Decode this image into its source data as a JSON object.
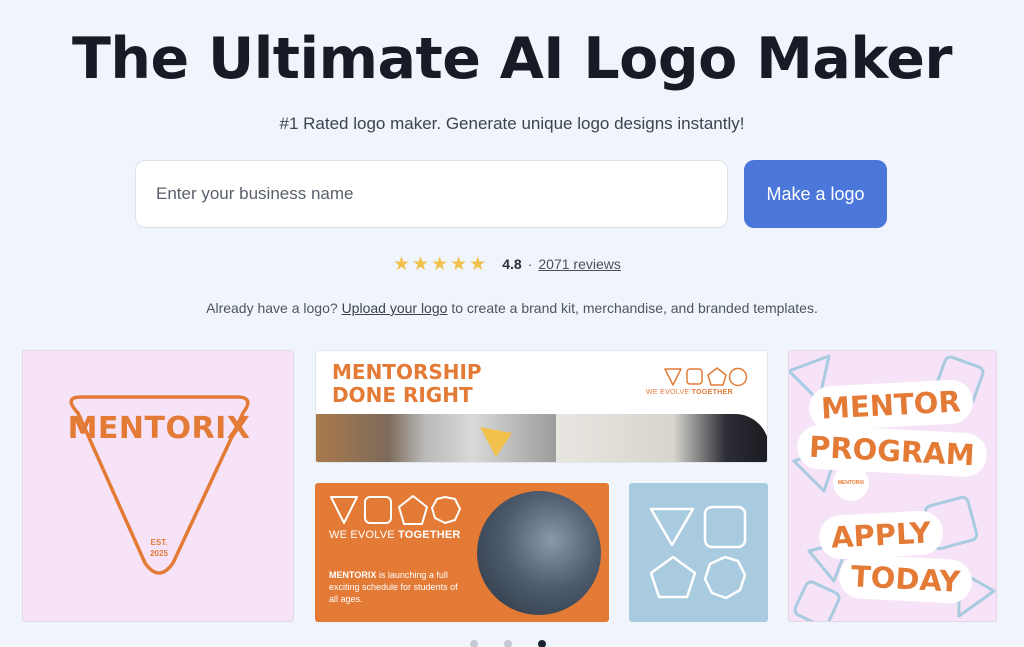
{
  "hero": {
    "title": "The Ultimate AI Logo Maker",
    "subtitle": "#1 Rated logo maker. Generate unique logo designs instantly!"
  },
  "search": {
    "placeholder": "Enter your business name",
    "value": "",
    "button_label": "Make a logo"
  },
  "rating": {
    "stars": 5,
    "value": "4.8",
    "separator": "·",
    "reviews_label": "2071 reviews"
  },
  "upload": {
    "prefix": "Already have a logo?",
    "link": "Upload your logo",
    "suffix": "to create a brand kit, merchandise, and branded templates."
  },
  "gallery": {
    "card1": {
      "brand": "MENTORIX",
      "est_line1": "EST.",
      "est_line2": "2025"
    },
    "card2": {
      "title_line1": "MENTORSHIP",
      "title_line2": "DONE RIGHT",
      "tag_prefix": "WE EVOLVE",
      "tag_bold": "TOGETHER"
    },
    "card3": {
      "tag_prefix": "WE EVOLVE",
      "tag_bold": "TOGETHER",
      "body_bold": "MENTORIX",
      "body_rest": "is launching a full exciting schedule for students of all ages."
    },
    "card5": {
      "line1": "MENTOR",
      "line2": "PROGRAM",
      "line3": "APPLY",
      "line4": "TODAY",
      "badge": "MENTORIX"
    }
  },
  "colors": {
    "accent": "#4a77d9",
    "brand_orange": "#e37a36",
    "star": "#f2c14b",
    "pink_bg": "#f6e3f7",
    "blue_bg": "#a9cbe0"
  },
  "pager": {
    "count": 3,
    "active_index": 2
  }
}
